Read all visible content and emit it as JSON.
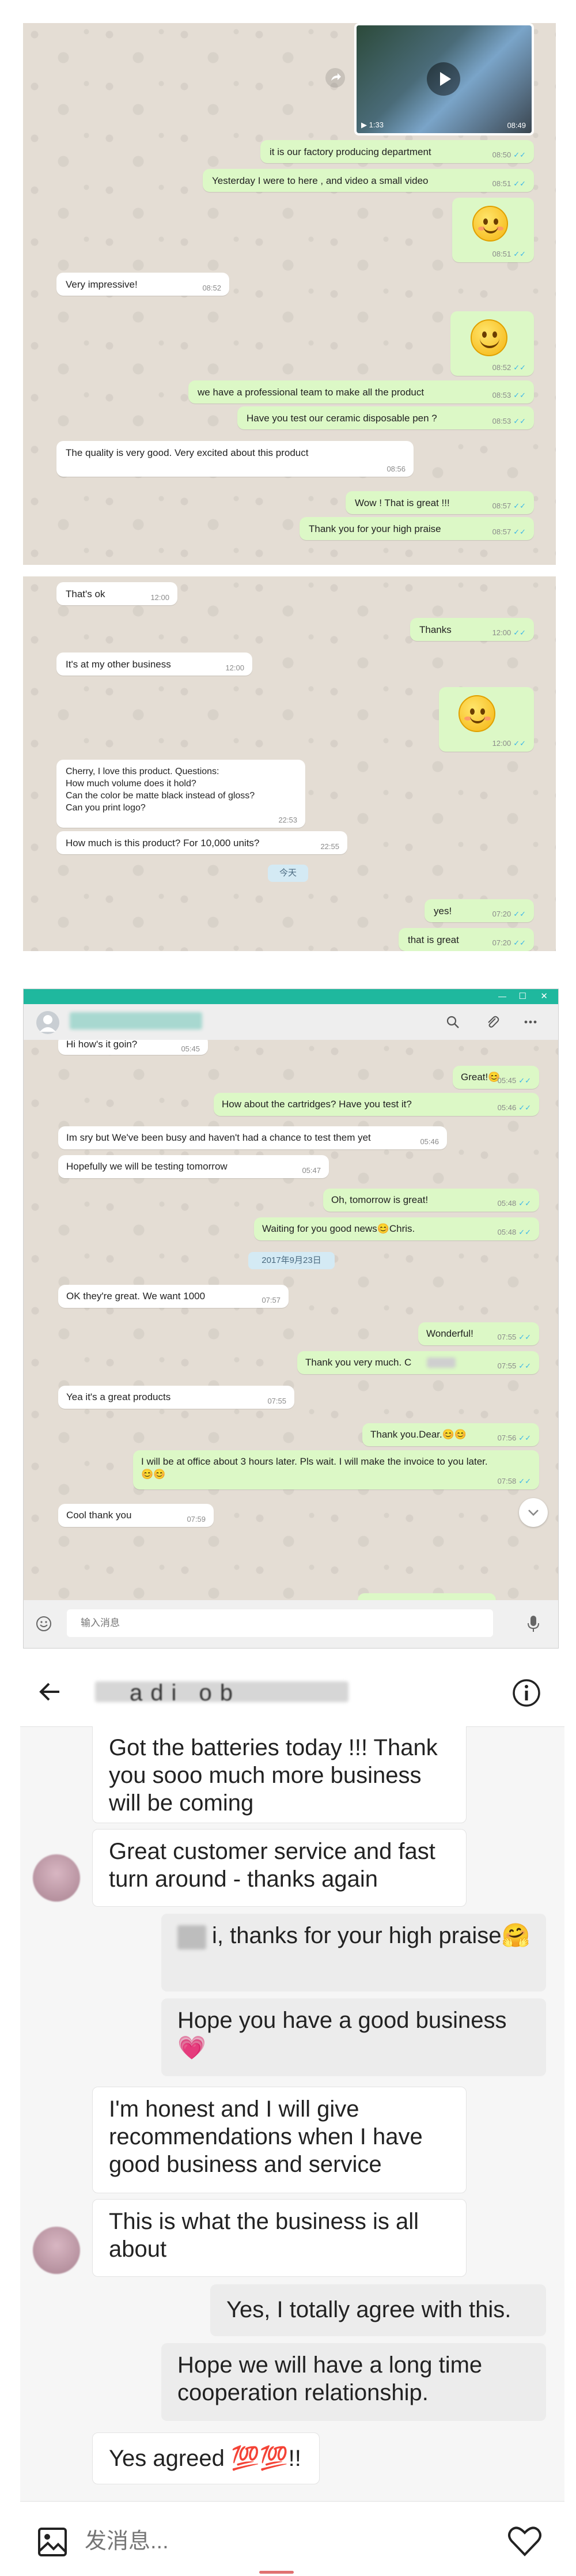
{
  "panel1": {
    "video": {
      "duration": "1:33",
      "time": "08:49",
      "play_icon": "play-icon",
      "forward_icon": "forward-icon"
    },
    "messages": [
      {
        "dir": "out",
        "text": "it is our factory producing department",
        "time": "08:50"
      },
      {
        "dir": "out",
        "text": "Yesterday I were to here , and video a small video",
        "time": "08:51"
      },
      {
        "dir": "out",
        "emoji": "smiling-face-emoji",
        "time": "08:51"
      },
      {
        "dir": "in",
        "text": "Very impressive!",
        "time": "08:52"
      },
      {
        "dir": "out",
        "emoji": "grinning-face-emoji",
        "time": "08:52"
      },
      {
        "dir": "out",
        "text": "we have a professional team to make all the product",
        "time": "08:53"
      },
      {
        "dir": "out",
        "text": "Have you test our ceramic disposable pen ?",
        "time": "08:53"
      },
      {
        "dir": "in",
        "text": "The quality is very good. Very excited about this product",
        "time": "08:56"
      },
      {
        "dir": "out",
        "text": "Wow ! That is great !!!",
        "time": "08:57"
      },
      {
        "dir": "out",
        "text": "Thank you for your high praise",
        "time": "08:57"
      }
    ]
  },
  "panel2": {
    "messages": [
      {
        "dir": "in",
        "text": "That's ok",
        "time": "12:00"
      },
      {
        "dir": "out",
        "text": "Thanks",
        "time": "12:00"
      },
      {
        "dir": "in",
        "text": "It's at my other business",
        "time": "12:00"
      },
      {
        "dir": "out",
        "emoji": "smiling-face-emoji",
        "time": "12:00"
      },
      {
        "dir": "in",
        "text": "Cherry, I love this product. Questions:\nHow much volume does it hold?\nCan the color be matte black instead of gloss?\nCan you print logo?",
        "time": "22:53"
      },
      {
        "dir": "in",
        "text": "How much is this product? For 10,000 units?",
        "time": "22:55"
      },
      {
        "dir": "out",
        "text": "yes!",
        "time": "07:20"
      },
      {
        "dir": "out",
        "text": "that is great",
        "time": "07:20"
      }
    ],
    "date_divider": "今天"
  },
  "panel3": {
    "window_controls": {
      "minimize": "—",
      "maximize": "☐",
      "close": "✕"
    },
    "contact_name": "",
    "search_icon": "search-icon",
    "attach_icon": "paperclip-icon",
    "more_icon": "more-icon",
    "messages": [
      {
        "dir": "in",
        "text": "Hi how's it goin?",
        "time": "05:45"
      },
      {
        "dir": "out",
        "text": "Great!😊",
        "time": "05:45"
      },
      {
        "dir": "out",
        "text": "How about the cartridges? Have you test it?",
        "time": "05:46"
      },
      {
        "dir": "in",
        "text": "Im sry but We've been busy and haven't had a chance to test them yet",
        "time": "05:46"
      },
      {
        "dir": "in",
        "text": "Hopefully we will be testing tomorrow",
        "time": "05:47"
      },
      {
        "dir": "out",
        "text": "Oh, tomorrow is great!",
        "time": "05:48"
      },
      {
        "dir": "out",
        "text": "Waiting for you good news😊Chris.",
        "time": "05:48"
      },
      {
        "dir": "in",
        "text": "OK they're great. We want 1000",
        "time": "07:57"
      },
      {
        "dir": "out",
        "text": "Wonderful!",
        "time": "07:55"
      },
      {
        "dir": "out",
        "text": "Thank you very much. C",
        "time": "07:55"
      },
      {
        "dir": "in",
        "text": "Yea it's a great products",
        "time": "07:55"
      },
      {
        "dir": "out",
        "text": "Thank you.Dear.😊😊",
        "time": "07:56"
      },
      {
        "dir": "out",
        "text": "I will be at office about 3 hours later. Pls wait. I will make the invoice to you later.😊😊",
        "time": "07:58"
      },
      {
        "dir": "in",
        "text": "Cool thank you",
        "time": "07:59"
      }
    ],
    "date_divider": "2017年9月23日",
    "input_placeholder": "输入消息",
    "emoji_icon": "emoji-icon",
    "mic_icon": "microphone-icon",
    "scroll_down_icon": "chevron-down-icon"
  },
  "panel4": {
    "back_icon": "back-arrow-icon",
    "contact_name": "adi ob",
    "info_icon": "info-icon",
    "messages": [
      {
        "dir": "in",
        "text": "Got the batteries today !!! Thank you sooo much more business will be coming"
      },
      {
        "dir": "in",
        "text": "Great customer service and fast turn around - thanks again"
      },
      {
        "dir": "out",
        "text": "i, thanks for your high praise🤗"
      },
      {
        "dir": "out",
        "text": "Hope you have a good business💗"
      },
      {
        "dir": "in",
        "text": "I'm honest and I will give recommendations when I have good business and service"
      },
      {
        "dir": "in",
        "text": "This is what the business is all about"
      },
      {
        "dir": "out",
        "text": "Yes, I totally agree with this."
      },
      {
        "dir": "out",
        "text": "Hope we will have a long time cooperation relationship."
      },
      {
        "dir": "in",
        "text": "Yes agreed 💯💯!!"
      }
    ],
    "input_placeholder": "发消息...",
    "image_icon": "image-icon",
    "heart_icon": "heart-icon"
  }
}
